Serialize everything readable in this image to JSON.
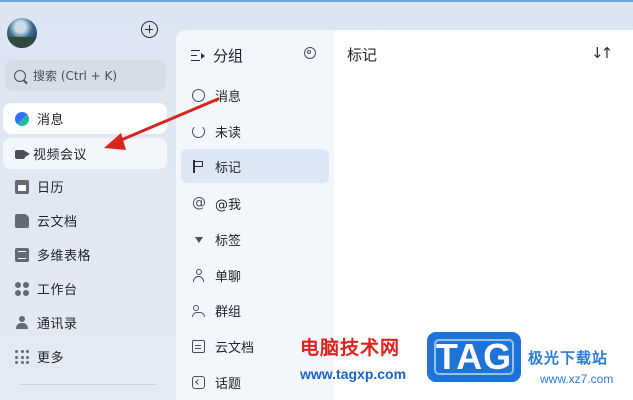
{
  "sidebar": {
    "search_placeholder": "搜索 (Ctrl + K)",
    "items": [
      {
        "label": "消息",
        "icon": "chat-bubble-icon",
        "active": true
      },
      {
        "label": "视频会议",
        "icon": "video-camera-icon"
      },
      {
        "label": "日历",
        "icon": "calendar-icon"
      },
      {
        "label": "云文档",
        "icon": "document-icon"
      },
      {
        "label": "多维表格",
        "icon": "table-icon"
      },
      {
        "label": "工作台",
        "icon": "workspace-icon"
      },
      {
        "label": "通讯录",
        "icon": "contacts-icon"
      },
      {
        "label": "更多",
        "icon": "more-dots-icon"
      }
    ]
  },
  "middle": {
    "title": "分组",
    "items": [
      {
        "label": "消息",
        "icon": "message-icon"
      },
      {
        "label": "未读",
        "icon": "unread-icon"
      },
      {
        "label": "标记",
        "icon": "flag-icon",
        "selected": true
      },
      {
        "label": "@我",
        "icon": "at-icon"
      },
      {
        "label": "标签",
        "icon": "caret-down-icon"
      },
      {
        "label": "单聊",
        "icon": "person-icon"
      },
      {
        "label": "群组",
        "icon": "group-icon"
      },
      {
        "label": "云文档",
        "icon": "docs-icon"
      },
      {
        "label": "话题",
        "icon": "topic-icon"
      }
    ]
  },
  "right": {
    "title": "标记",
    "sort_symbol": "↓↑"
  },
  "watermark": {
    "site_name": "电脑技术网",
    "site_url": "www.tagxp.com",
    "logo_text": "TAG",
    "right_name": "极光下载站",
    "right_url": "www.xz7.com"
  },
  "colors": {
    "accent": "#3370ff",
    "selected_bg": "#dde7f6",
    "annotation_arrow": "#d9261c"
  }
}
